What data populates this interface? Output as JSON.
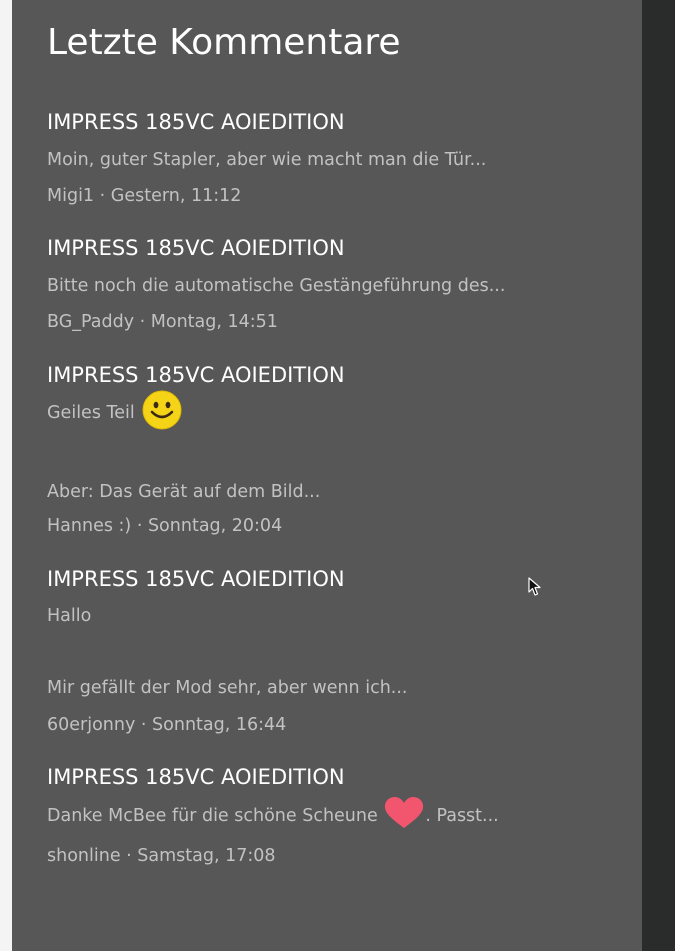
{
  "widget": {
    "title": "Letzte Kommentare"
  },
  "comments": [
    {
      "title": "IMPRESS 185VC AOIEDITION",
      "line1": "Moin, guter Stapler, aber wie macht man die Tür...",
      "author": "Migi1",
      "separator": " · ",
      "time": "Gestern, 11:12"
    },
    {
      "title": "IMPRESS 185VC AOIEDITION",
      "line1": "Bitte noch die automatische Gestängeführung des...",
      "author": "BG_Paddy",
      "separator": " · ",
      "time": "Montag, 14:51"
    },
    {
      "title": "IMPRESS 185VC AOIEDITION",
      "line1": "Geiles Teil",
      "line1_icon": "smiley-face-icon",
      "line2": "Aber: Das Gerät auf dem Bild...",
      "author": "Hannes :)",
      "separator": " · ",
      "time": "Sonntag, 20:04"
    },
    {
      "title": "IMPRESS 185VC AOIEDITION",
      "line1": "Hallo",
      "line2": "Mir gefällt der Mod sehr, aber wenn ich...",
      "author": "60erjonny",
      "separator": " · ",
      "time": "Sonntag, 16:44"
    },
    {
      "title": "IMPRESS 185VC AOIEDITION",
      "line1_before": "Danke McBee für die schöne Scheune ",
      "line1_icon": "heart-icon",
      "line1_after": ". Passt...",
      "author": "shonline",
      "separator": " · ",
      "time": "Samstag, 17:08"
    }
  ],
  "colors": {
    "panel": "#575757",
    "title": "#ffffff",
    "muted_text": "#c2c2c2",
    "emoji_yellow": "#f5d418",
    "heart": "#f2566e",
    "right_strip": "#2a2c2c"
  }
}
